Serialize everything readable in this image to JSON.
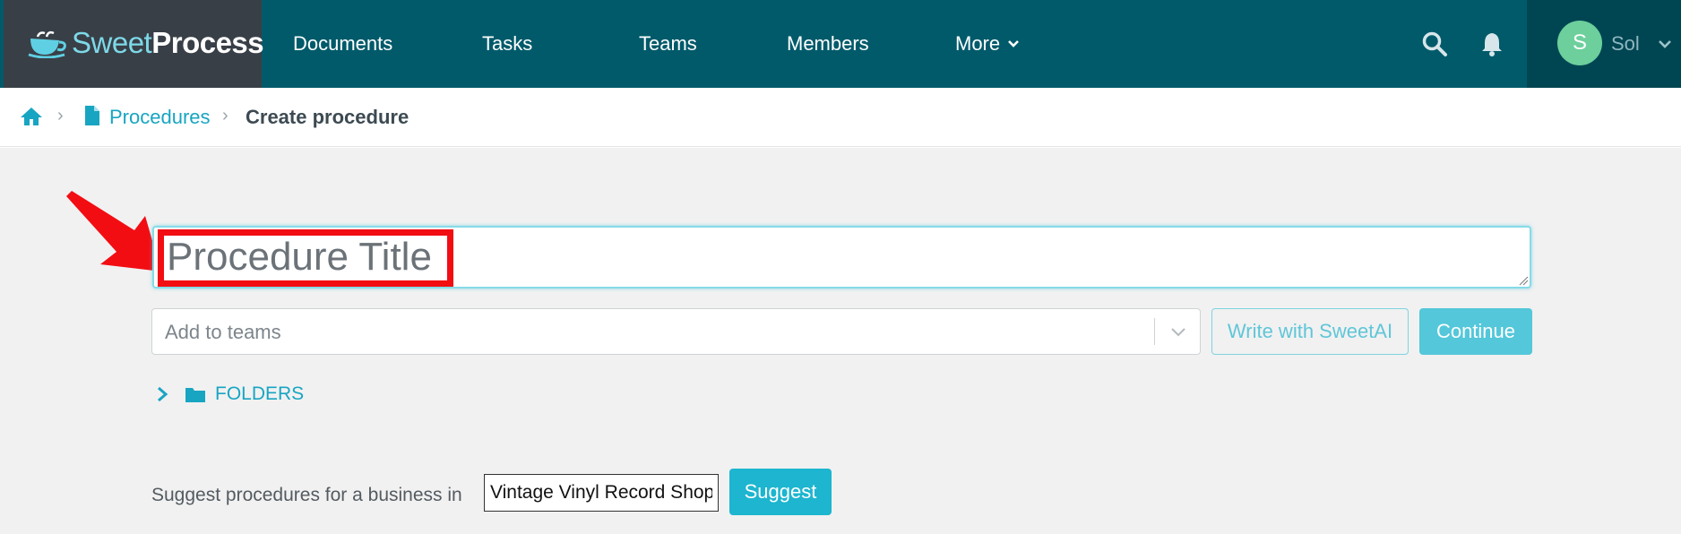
{
  "app": {
    "logo_light": "Sweet",
    "logo_bold": "Process"
  },
  "nav": {
    "items": [
      {
        "label": "Documents"
      },
      {
        "label": "Tasks"
      },
      {
        "label": "Teams"
      },
      {
        "label": "Members"
      },
      {
        "label": "More"
      }
    ],
    "icons": [
      "search-icon",
      "bell-icon"
    ]
  },
  "user": {
    "initial": "S",
    "name": "Sol",
    "avatar_color": "#6ccf9c"
  },
  "breadcrumb": {
    "home_icon": "home-icon",
    "procedures": "Procedures",
    "current": "Create procedure"
  },
  "form": {
    "title_placeholder": "Procedure Title",
    "teams_placeholder": "Add to teams",
    "sweetai_label": "Write with SweetAI",
    "continue_label": "Continue",
    "folders_label": "FOLDERS"
  },
  "suggest": {
    "label": "Suggest procedures for a business in",
    "value": "Vintage Vinyl Record Shop",
    "button_label": "Suggest"
  },
  "colors": {
    "nav_bg": "#005a6a",
    "logo_bg": "#393f47",
    "accent": "#18a5c2",
    "highlight": "#f20d13"
  }
}
